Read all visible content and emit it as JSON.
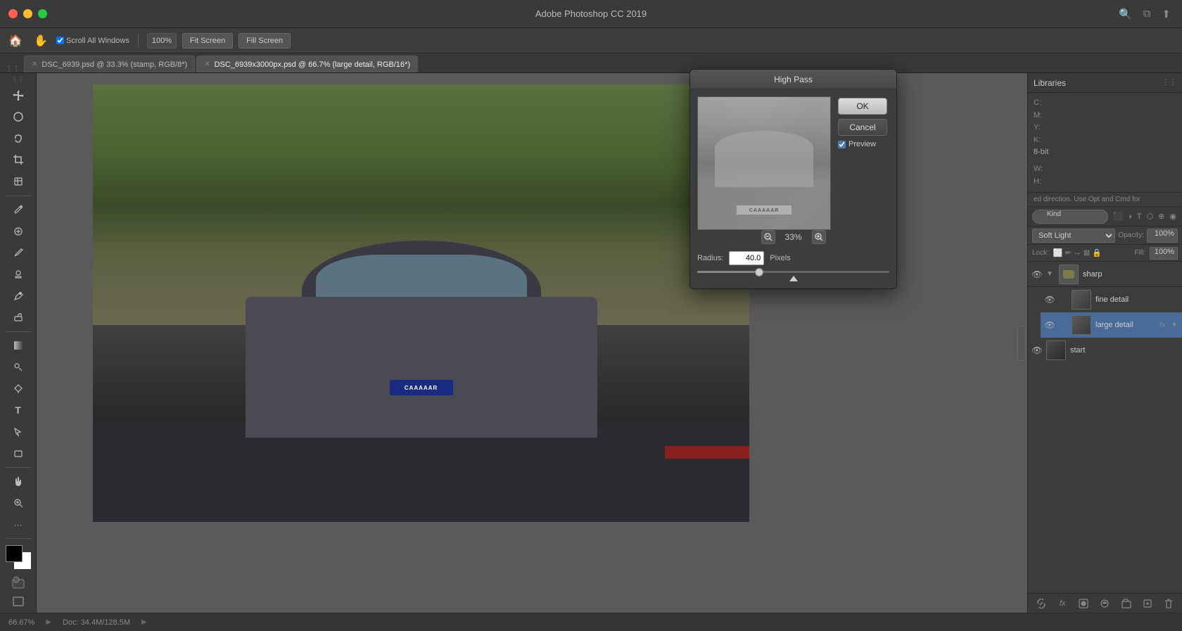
{
  "app": {
    "title": "Adobe Photoshop CC 2019",
    "window_controls": {
      "close": "close",
      "minimize": "minimize",
      "maximize": "maximize"
    }
  },
  "toolbar": {
    "scroll_all_windows": "Scroll All Windows",
    "zoom_level": "100%",
    "fit_screen": "Fit Screen",
    "fill_screen": "Fill Screen"
  },
  "tabs": [
    {
      "label": "DSC_6939.psd @ 33.3% (stamp, RGB/8*)",
      "active": false,
      "modified": true
    },
    {
      "label": "DSC_6939x3000px.psd @ 66.7% (large detail, RGB/16*)",
      "active": true,
      "modified": true
    }
  ],
  "high_pass_dialog": {
    "title": "High Pass",
    "ok_label": "OK",
    "cancel_label": "Cancel",
    "preview_label": "Preview",
    "zoom_level": "33%",
    "radius_label": "Radius:",
    "radius_value": "40.0",
    "radius_unit": "Pixels"
  },
  "info_panel": {
    "c_label": "C:",
    "m_label": "M:",
    "y_label": "Y:",
    "k_label": "K:",
    "bit_depth": "8-bit",
    "w_label": "W:",
    "h_label": "H:"
  },
  "layers_panel": {
    "title": "Libraries",
    "filter_placeholder": "Kind",
    "blend_mode": "Soft Light",
    "opacity_label": "Opacity:",
    "opacity_value": "100%",
    "lock_label": "Lock:",
    "fill_label": "Fill:",
    "fill_value": "100%",
    "layers": [
      {
        "name": "sharp",
        "type": "group",
        "visible": true,
        "expanded": true,
        "indent": 0
      },
      {
        "name": "fine detail",
        "type": "layer",
        "visible": true,
        "expanded": false,
        "indent": 1
      },
      {
        "name": "large detail",
        "type": "layer",
        "visible": true,
        "expanded": false,
        "indent": 1,
        "active": true,
        "has_fx": true
      },
      {
        "name": "start",
        "type": "layer",
        "visible": true,
        "expanded": false,
        "indent": 0
      }
    ],
    "bottom_bar_buttons": [
      "link",
      "fx",
      "mask",
      "adjustment",
      "folder",
      "trash"
    ]
  },
  "status_bar": {
    "zoom": "66.67%",
    "doc_size": "Doc: 34.4M/128.5M"
  }
}
